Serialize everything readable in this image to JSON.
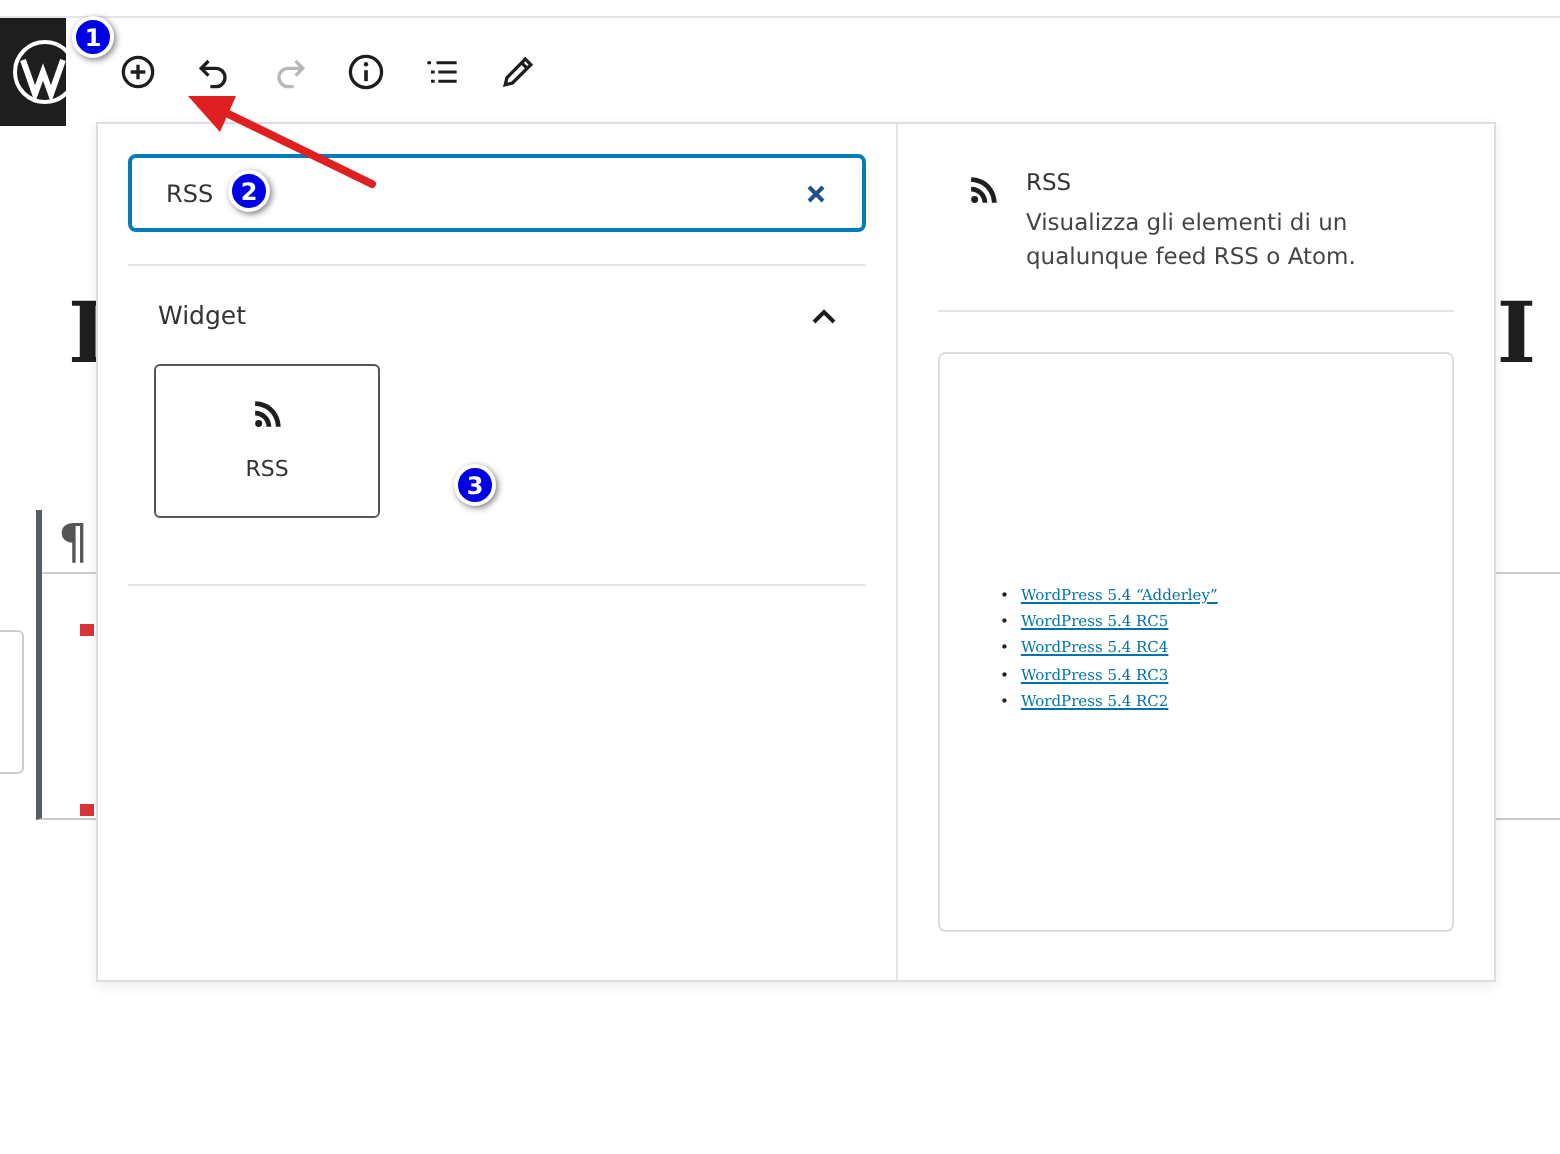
{
  "toolbar": {
    "buttons": [
      {
        "kind": "inserter",
        "disabled": false
      },
      {
        "kind": "undo",
        "disabled": false
      },
      {
        "kind": "redo",
        "disabled": true
      },
      {
        "kind": "info",
        "disabled": false
      },
      {
        "kind": "outline",
        "disabled": false
      },
      {
        "kind": "edit",
        "disabled": false
      }
    ]
  },
  "editor": {
    "title_fragments": [
      "I",
      "I"
    ],
    "paragraph_marker": "¶"
  },
  "inserter": {
    "search": {
      "value": "RSS"
    },
    "categories": [
      {
        "title": "Widget",
        "expanded": true,
        "blocks": [
          {
            "label": "RSS"
          }
        ]
      }
    ],
    "preview": {
      "title": "RSS",
      "bullet": "•",
      "description": "Visualizza gli elementi di un qualunque feed RSS o Atom.",
      "links": [
        "WordPress 5.4 “Adderley”",
        "WordPress 5.4 RC5",
        "WordPress 5.4 RC4",
        "WordPress 5.4 RC3",
        "WordPress 5.4 RC2"
      ]
    }
  },
  "annotations": [
    {
      "label": "1"
    },
    {
      "label": "2"
    },
    {
      "label": "3"
    }
  ]
}
